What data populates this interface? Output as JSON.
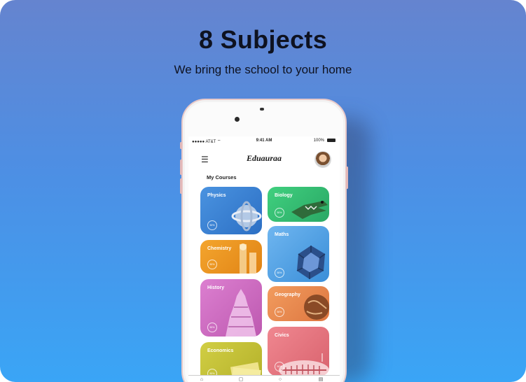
{
  "header": {
    "title": "8 Subjects",
    "subtitle": "We bring the school to your home"
  },
  "status_bar": {
    "carrier": "●●●●● AT&T ⌔",
    "time": "9:41 AM",
    "battery": "100%"
  },
  "app": {
    "brand": "Eduauraa",
    "section_title": "My Courses"
  },
  "courses": [
    {
      "name": "Physics",
      "progress": "50%",
      "color": "#3d84d6"
    },
    {
      "name": "Biology",
      "progress": "50%",
      "color": "#3cc27a"
    },
    {
      "name": "Maths",
      "progress": "50%",
      "color": "#5aa6e8"
    },
    {
      "name": "Chemistry",
      "progress": "50%",
      "color": "#ef9b24"
    },
    {
      "name": "History",
      "progress": "50%",
      "color": "#d36fc6"
    },
    {
      "name": "Geography",
      "progress": "50%",
      "color": "#ee8d52"
    },
    {
      "name": "Economics",
      "progress": "50%",
      "color": "#c7c43a"
    },
    {
      "name": "Civics",
      "progress": "50%",
      "color": "#ec7a84"
    }
  ],
  "tab_icons": [
    "home-icon",
    "courses-icon",
    "profile-icon",
    "library-icon"
  ]
}
